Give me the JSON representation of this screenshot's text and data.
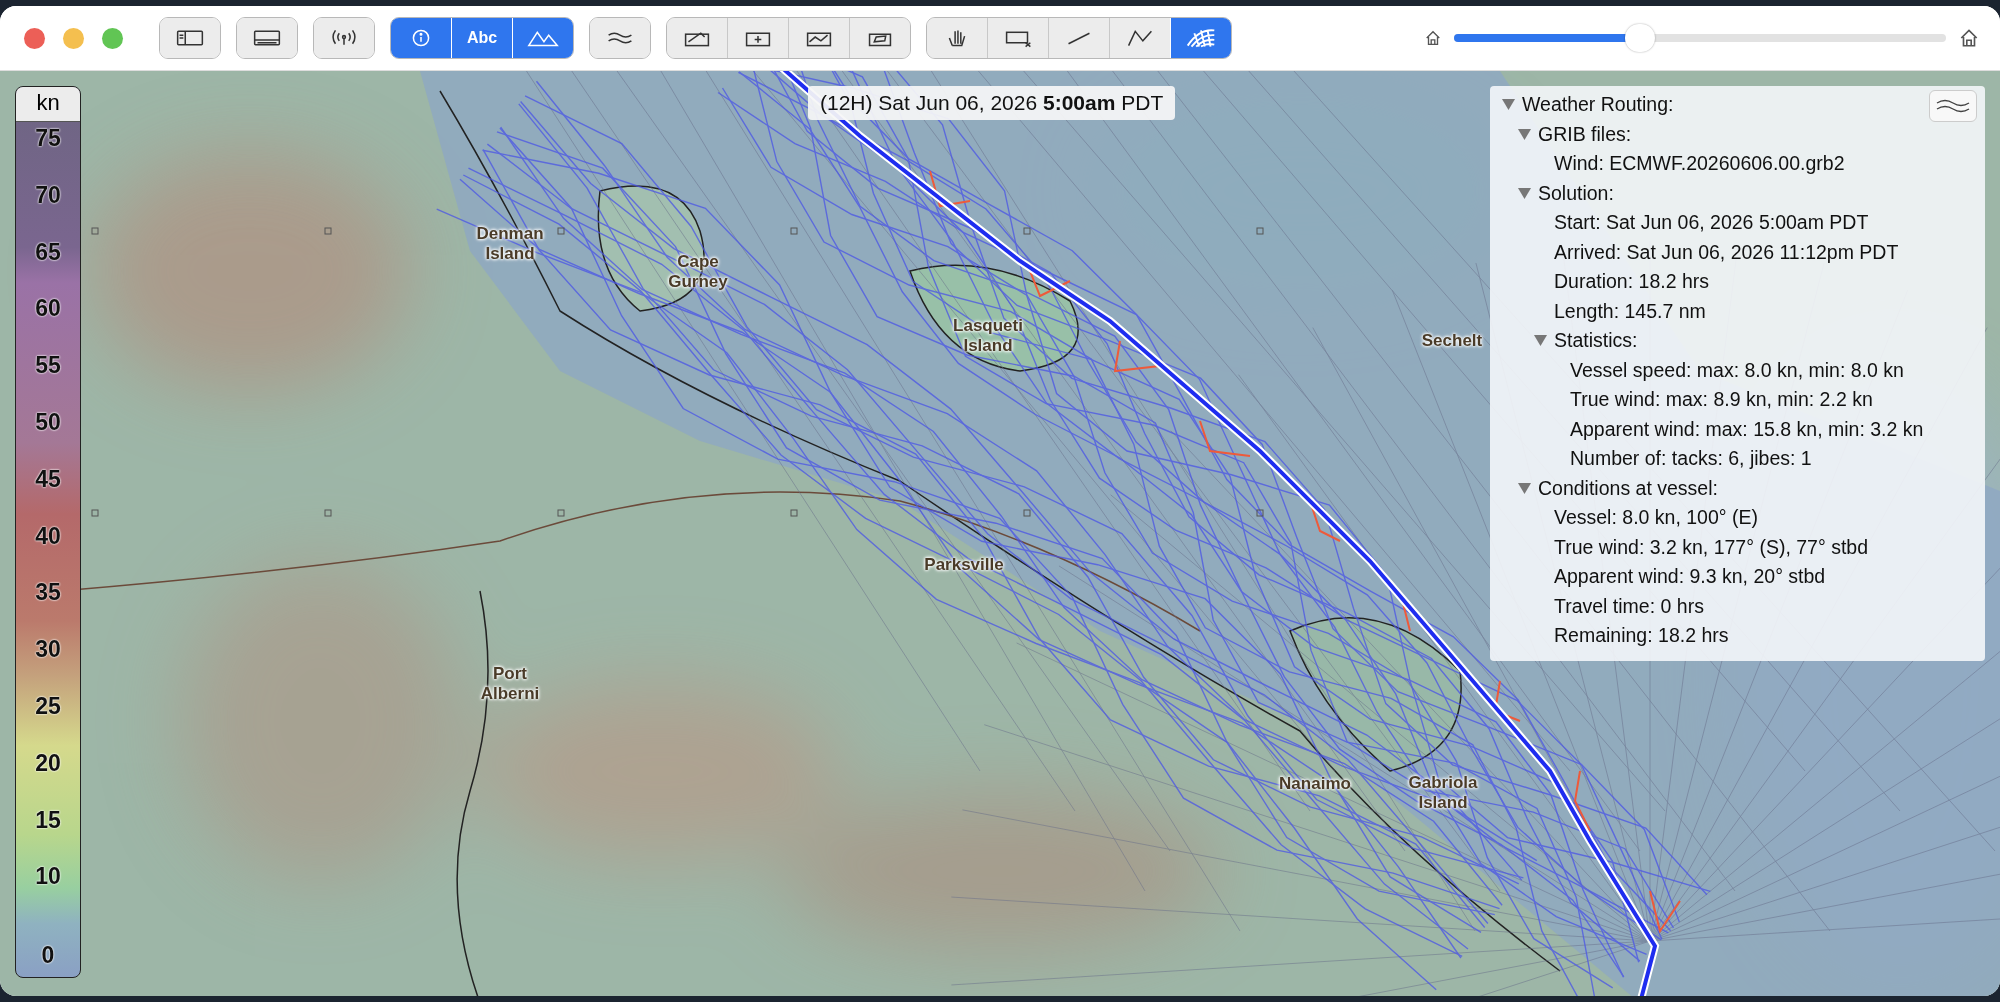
{
  "window": {
    "controls": [
      {
        "kind": "close"
      },
      {
        "kind": "minimize"
      },
      {
        "kind": "zoom"
      }
    ]
  },
  "toolbar": {
    "groups": [
      {
        "buttons": [
          {
            "kind": "sidebar",
            "selected": false
          }
        ]
      },
      {
        "buttons": [
          {
            "kind": "panel",
            "selected": false
          }
        ]
      },
      {
        "buttons": [
          {
            "kind": "broadcast",
            "selected": false
          }
        ]
      },
      {
        "buttons": [
          {
            "kind": "info",
            "selected": true
          },
          {
            "kind": "labels",
            "label": "Abc",
            "selected": true
          },
          {
            "kind": "mountains",
            "selected": true
          }
        ]
      },
      {
        "buttons": [
          {
            "kind": "waves",
            "selected": false
          }
        ]
      },
      {
        "buttons": [
          {
            "kind": "chart-pen",
            "selected": false
          },
          {
            "kind": "chart-add",
            "selected": false
          },
          {
            "kind": "chart-line",
            "selected": false
          },
          {
            "kind": "chart-tag",
            "selected": false
          }
        ]
      },
      {
        "buttons": [
          {
            "kind": "hand",
            "selected": false
          },
          {
            "kind": "rect-x",
            "selected": false
          },
          {
            "kind": "line",
            "selected": false
          },
          {
            "kind": "polyline",
            "selected": false
          },
          {
            "kind": "routing",
            "selected": true
          }
        ]
      }
    ]
  },
  "time_slider": {
    "level": 0.37
  },
  "legend": {
    "unit": "kn",
    "ticks": [
      "75",
      "70",
      "65",
      "60",
      "55",
      "50",
      "45",
      "40",
      "35",
      "30",
      "25",
      "20",
      "15",
      "10",
      "0"
    ]
  },
  "timestamp": "(12H) Sat Jun 06, 2026 **5:00am** PDT",
  "map_labels": [
    {
      "text": "Denman Island"
    },
    {
      "text": "Cape Gurney"
    },
    {
      "text": "Lasqueti Island"
    },
    {
      "text": "Sechelt"
    },
    {
      "text": "Parksville"
    },
    {
      "text": "Port Alberni"
    },
    {
      "text": "Nanaimo"
    },
    {
      "text": "Gabriola Island"
    }
  ],
  "info_panel": {
    "tree": [
      {
        "text": "Weather Routing:",
        "expanded": true,
        "children": [
          {
            "text": "GRIB files:",
            "expanded": true,
            "children": [
              {
                "text": "Wind: ECMWF.20260606.00.grb2"
              }
            ]
          },
          {
            "text": "Solution:",
            "expanded": true,
            "children": [
              {
                "text": "Start: Sat Jun 06, 2026 5:00am PDT"
              },
              {
                "text": "Arrived: Sat Jun 06, 2026 11:12pm PDT"
              },
              {
                "text": "Duration: 18.2 hrs"
              },
              {
                "text": "Length: 145.7 nm"
              },
              {
                "text": "Statistics:",
                "expanded": true,
                "children": [
                  {
                    "text": "Vessel speed: max: 8.0 kn, min: 8.0 kn"
                  },
                  {
                    "text": "True wind: max: 8.9 kn, min: 2.2 kn"
                  },
                  {
                    "text": "Apparent wind: max: 15.8 kn, min: 3.2 kn"
                  },
                  {
                    "text": "Number of: tacks: 6, jibes: 1"
                  }
                ]
              }
            ]
          },
          {
            "text": "Conditions at vessel:",
            "expanded": true,
            "children": [
              {
                "text": "Vessel: 8.0 kn, 100° (E)"
              },
              {
                "text": "True wind: 3.2 kn, 177° (S), 77° stbd"
              },
              {
                "text": "Apparent wind: 9.3 kn, 20° stbd"
              },
              {
                "text": "Travel time: 0 hrs"
              },
              {
                "text": "Remaining: 18.2 hrs"
              }
            ]
          }
        ]
      }
    ]
  }
}
